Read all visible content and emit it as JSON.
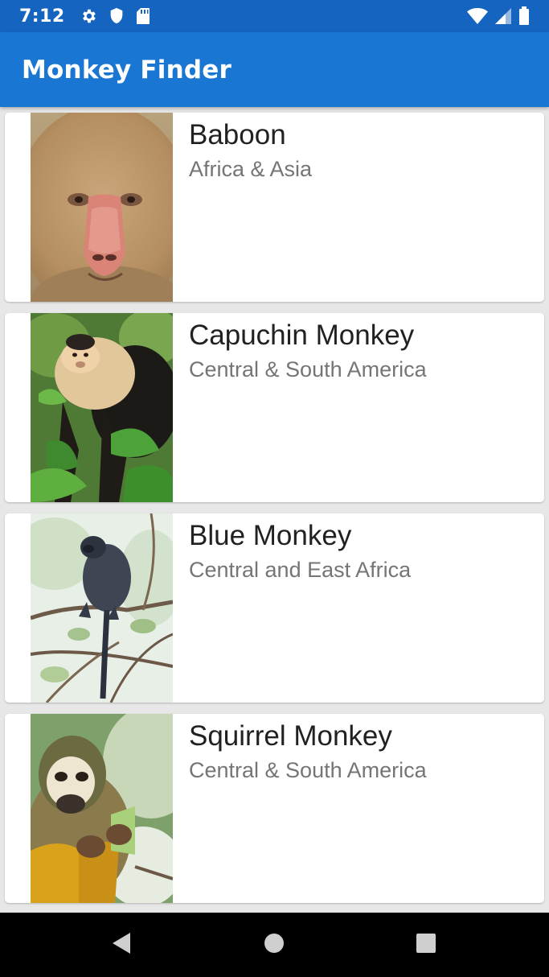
{
  "status_bar": {
    "time": "7:12",
    "left_icons": [
      "settings-icon",
      "shield-icon",
      "sd-card-icon"
    ],
    "right_icons": [
      "wifi-icon",
      "signal-icon",
      "battery-icon"
    ]
  },
  "app_bar": {
    "title": "Monkey Finder",
    "color": "#1976d2"
  },
  "monkeys": [
    {
      "name": "Baboon",
      "location": "Africa & Asia",
      "image": "baboon-photo"
    },
    {
      "name": "Capuchin Monkey",
      "location": "Central & South America",
      "image": "capuchin-photo"
    },
    {
      "name": "Blue Monkey",
      "location": "Central and East Africa",
      "image": "blue-monkey-photo"
    },
    {
      "name": "Squirrel Monkey",
      "location": "Central & South America",
      "image": "squirrel-monkey-photo"
    }
  ],
  "nav_bar": {
    "buttons": [
      "back-icon",
      "home-icon",
      "recents-icon"
    ]
  }
}
